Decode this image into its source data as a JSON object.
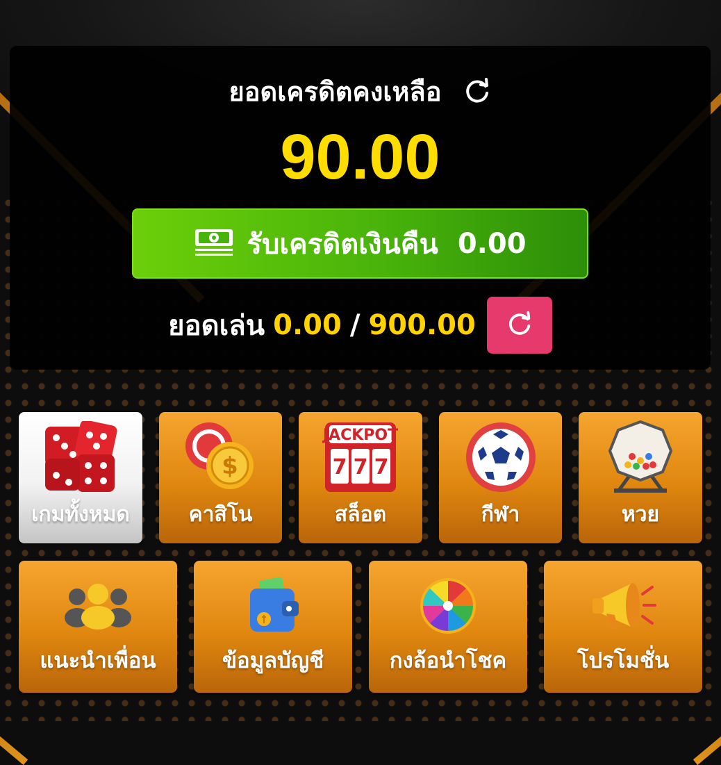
{
  "credit": {
    "title": "ยอดเครดิตคงเหลือ",
    "amount": "90.00",
    "refresh_icon": "refresh-icon"
  },
  "cashback": {
    "label": "รับเครดิตเงินคืน",
    "value": "0.00",
    "icon": "money-icon"
  },
  "turnover": {
    "label": "ยอดเล่น",
    "current": "0.00",
    "separator": "/",
    "target": "900.00",
    "refresh_icon": "refresh-icon"
  },
  "menu": {
    "row1": [
      {
        "label": "เกมทั้งหมด",
        "icon": "dice-icon",
        "active": true
      },
      {
        "label": "คาสิโน",
        "icon": "casino-chip-icon",
        "active": false
      },
      {
        "label": "สล็อต",
        "icon": "jackpot-slot-icon",
        "active": false
      },
      {
        "label": "กีฬา",
        "icon": "soccer-ball-icon",
        "active": false
      },
      {
        "label": "หวย",
        "icon": "lottery-wheel-icon",
        "active": false
      }
    ],
    "row2": [
      {
        "label": "แนะนำเพื่อน",
        "icon": "friends-icon"
      },
      {
        "label": "ข้อมูลบัญชี",
        "icon": "wallet-icon"
      },
      {
        "label": "กงล้อนำโชค",
        "icon": "lucky-wheel-icon"
      },
      {
        "label": "โปรโมชั่น",
        "icon": "megaphone-icon"
      }
    ]
  },
  "colors": {
    "accent_yellow": "#ffdd00",
    "cashback_green": "#48b30a",
    "refresh_pink": "#e63a6c",
    "tile_orange": "#e0870f"
  }
}
